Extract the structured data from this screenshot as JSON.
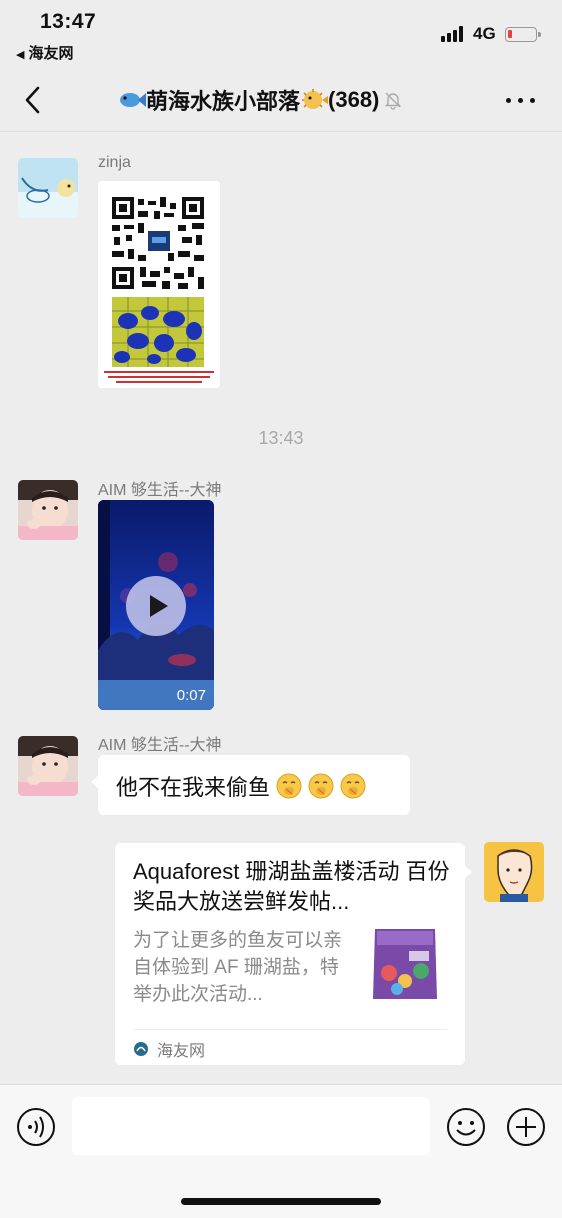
{
  "status_bar": {
    "time": "13:47",
    "back_app": "海友网",
    "network": "4G"
  },
  "header": {
    "title": "萌海水族小部落",
    "member_count": "(368)",
    "title_icons": [
      "fish-emoji-icon",
      "pufferfish-emoji-icon",
      "mute-bell-icon"
    ]
  },
  "messages": [
    {
      "type": "image",
      "sender": "zinja",
      "avatar": "cartoon-avatar"
    },
    {
      "type": "time",
      "text": "13:43"
    },
    {
      "type": "video",
      "sender": "AIM 够生活--大神",
      "duration": "0:07"
    },
    {
      "type": "text",
      "sender": "AIM 够生活--大神",
      "text": "他不在我来偷鱼",
      "emojis": [
        "hush-emoji",
        "hush-emoji",
        "hush-emoji"
      ]
    },
    {
      "type": "link",
      "outgoing": true,
      "title": "Aquaforest 珊湖盐盖楼活动 百份奖品大放送尝鲜发帖...",
      "description": "为了让更多的鱼友可以亲自体验到 AF 珊湖盐，特举办此次活动...",
      "source": "海友网"
    }
  ],
  "input_bar": {
    "placeholder": ""
  },
  "colors": {
    "background": "#ededed",
    "bubble": "#ffffff",
    "sender_text": "#7a7a7a",
    "battery_low": "#e64340"
  }
}
